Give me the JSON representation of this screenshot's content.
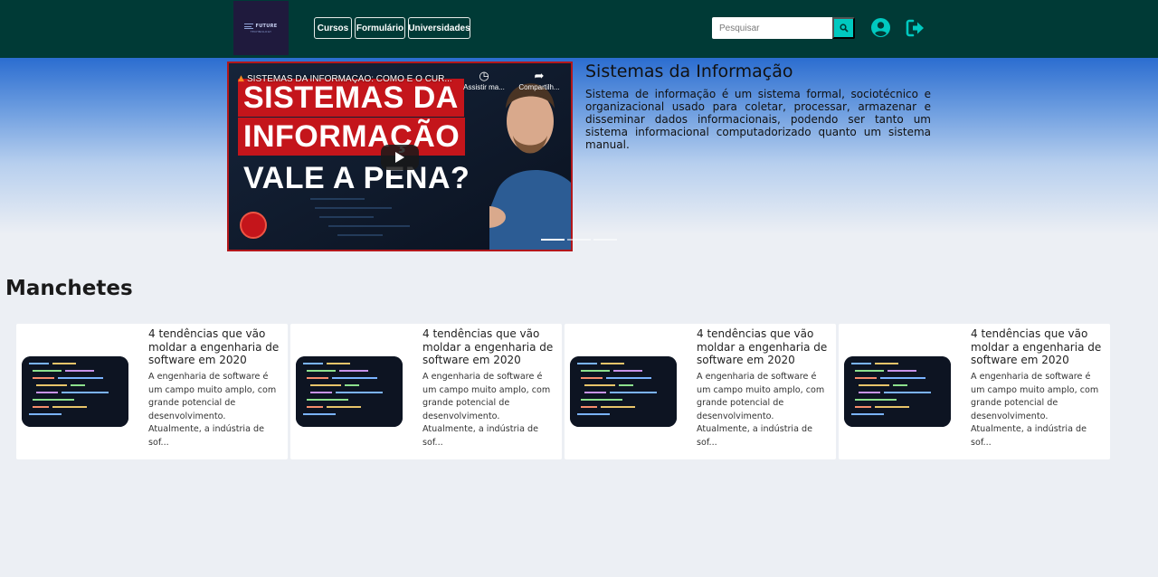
{
  "brand": {
    "logo_name": "FUTURE",
    "logo_sub": "TECHNOLOGY"
  },
  "nav": {
    "items": [
      {
        "label": "Cursos"
      },
      {
        "label": "Formulário"
      },
      {
        "label": "Universidades"
      }
    ],
    "search": {
      "placeholder": "Pesquisar"
    },
    "icons": {
      "search": "search-icon",
      "user": "user-circle-icon",
      "logout": "sign-out-icon"
    }
  },
  "hero": {
    "video": {
      "title": "SISTEMAS DA INFORMAÇÃO: COMO É O CUR...",
      "watch_later": "Assistir ma...",
      "share": "Compartilh...",
      "banner_lines": [
        "SISTEMAS DA",
        "INFORMAÇÃO",
        "VALE A PENA?"
      ]
    },
    "title": "Sistemas da Informação",
    "text": "Sistema de informação é um sistema formal, sociotécnico e organizacional usado para coletar, processar, armazenar e disseminar dados informacionais, podendo ser tanto um sistema informacional computadorizado quanto um sistema manual."
  },
  "manchetes": {
    "title": "Manchetes",
    "cards": [
      {
        "title": "4 tendências que vão moldar a engenharia de software em 2020",
        "desc": "A engenharia de software é um campo muito amplo, com grande potencial de desenvolvimento. Atualmente, a indústria de sof..."
      },
      {
        "title": "4 tendências que vão moldar a engenharia de software em 2020",
        "desc": "A engenharia de software é um campo muito amplo, com grande potencial de desenvolvimento. Atualmente, a indústria de sof..."
      },
      {
        "title": "4 tendências que vão moldar a engenharia de software em 2020",
        "desc": "A engenharia de software é um campo muito amplo, com grande potencial de desenvolvimento. Atualmente, a indústria de sof..."
      },
      {
        "title": "4 tendências que vão moldar a engenharia de software em 2020",
        "desc": "A engenharia de software é um campo muito amplo, com grande potencial de desenvolvimento. Atualmente, a indústria de sof..."
      }
    ]
  },
  "colors": {
    "navbar": "#003a36",
    "accent": "#00c9c0",
    "banner_red": "#c4151b",
    "page_bg": "#eceff4"
  }
}
